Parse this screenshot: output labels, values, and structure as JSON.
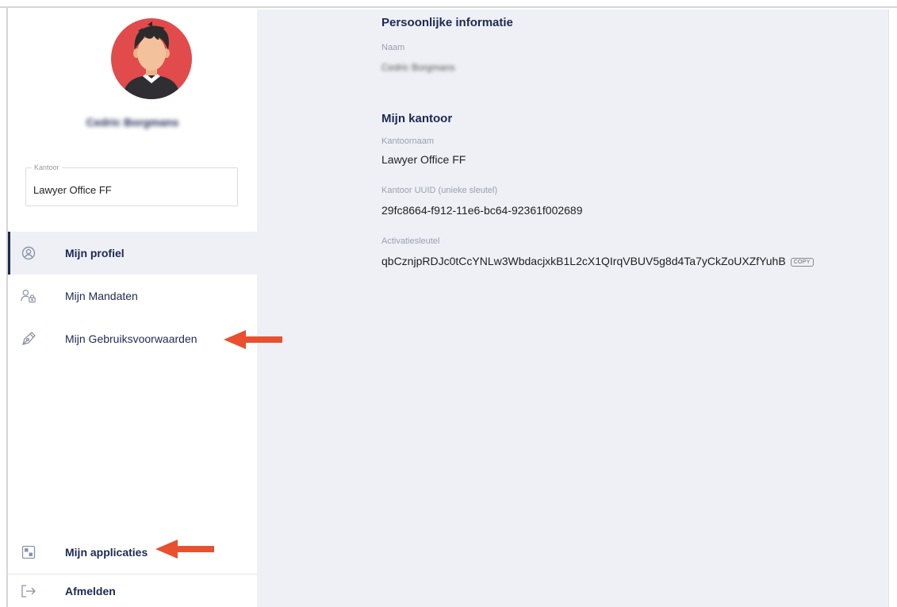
{
  "user": {
    "name": "Cedric Borgmans"
  },
  "kantoor_select": {
    "legend": "Kantoor",
    "value": "Lawyer Office FF"
  },
  "nav": {
    "profile": "Mijn profiel",
    "mandates": "Mijn Mandaten",
    "terms": "Mijn Gebruiksvoorwaarden",
    "applications": "Mijn applicaties",
    "logout": "Afmelden"
  },
  "personal": {
    "title": "Persoonlijke informatie",
    "name_label": "Naam",
    "name_value": "Cedric Borgmans"
  },
  "office": {
    "title": "Mijn kantoor",
    "name_label": "Kantoornaam",
    "name_value": "Lawyer Office FF",
    "uuid_label": "Kantoor UUID (unieke sleutel)",
    "uuid_value": "29fc8664-f912-11e6-bc64-92361f002689",
    "key_label": "Activatiesleutel",
    "key_value": "qbCznjpRDJc0tCcYNLw3WbdacjxkB1L2cX1QIrqVBUV5g8d4Ta7yCkZoUXZfYuhB",
    "copy_label": "COPY"
  },
  "colors": {
    "navy": "#1c2a52",
    "avatar_bg": "#e14b4b",
    "main_bg": "#eef0f5",
    "arrow": "#e8502f"
  },
  "icons": {
    "profile": "user-circle-icon",
    "mandates": "users-lock-icon",
    "terms": "pen-nib-icon",
    "applications": "app-grid-icon",
    "logout": "logout-icon"
  }
}
